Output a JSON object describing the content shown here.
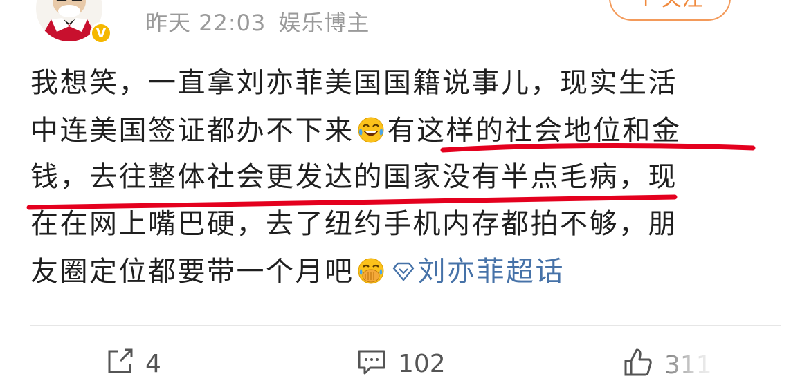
{
  "header": {
    "time": "昨天 22:03",
    "source": "娱乐博主",
    "follow_label": "+ 关注"
  },
  "post": {
    "line1": "我想笑，一直拿刘亦菲美国国籍说事儿，现实生活",
    "line2_a": "中连美国签证都办不下来",
    "line2_b": "有这样的社会地位和金",
    "line3": "钱，去往整体社会更发达的国家没有半点毛病，现",
    "line4": "在在网上嘴巴硬，去了纽约手机内存都拍不够，朋",
    "line5": "友圈定位都要带一个月吧",
    "topic": "刘亦菲超话"
  },
  "footer": {
    "share_count": "4",
    "comment_count": "102",
    "like_count": "311"
  },
  "icons": {
    "avatar": "avatar-icon",
    "verified": "verified-badge-icon",
    "laugh_cry": "laughing-crying-emoji",
    "giggle": "covering-mouth-emoji",
    "topic": "diamond-icon",
    "share": "share-icon",
    "comment": "comment-icon",
    "like": "thumbs-up-icon"
  },
  "colors": {
    "link": "#4672a8",
    "follow": "#f08a3e",
    "underline": "#e4001e",
    "meta": "#9a9a9a",
    "verified": "#f5b700"
  }
}
